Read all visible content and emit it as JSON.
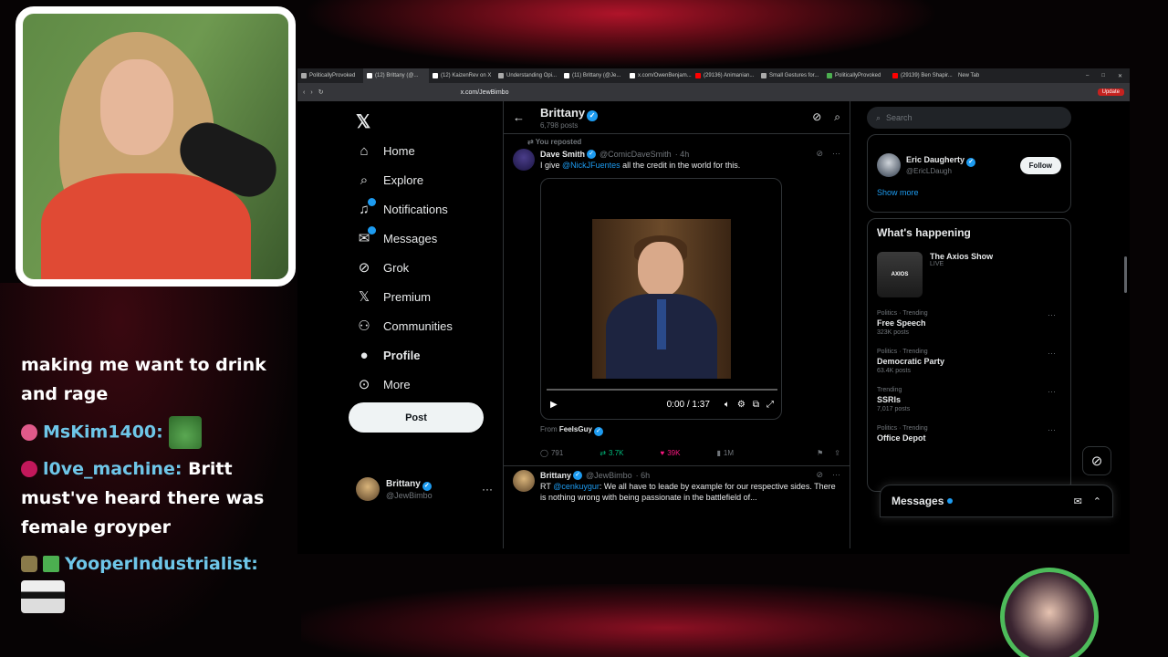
{
  "chat": {
    "line1": "making me want to drink and rage",
    "msg2_user": "MsKim1400:",
    "msg3_user": "l0ve_machine:",
    "msg3_text": "Britt must've heard there was female groyper",
    "msg4_user": "YooperIndustrialist:"
  },
  "browser": {
    "tabs": [
      "PoliticallyProvoked",
      "(12) Brittany (@...",
      "(12) KaizenRev on X",
      "Understanding Opi...",
      "(11) Brittany (@Je...",
      "x.com/OwenBenjam...",
      "(29136) Animanian...",
      "Small Gestures for...",
      "PoliticallyProvoked",
      "(29139) Ben Shapir...",
      "New Tab"
    ],
    "url": "x.com/JewBimbo",
    "update_label": "Update"
  },
  "nav": {
    "items": [
      "Home",
      "Explore",
      "Notifications",
      "Messages",
      "Grok",
      "Premium",
      "Communities",
      "Profile",
      "More"
    ],
    "post_label": "Post",
    "account_name": "Brittany",
    "account_handle": "@JewBimbo"
  },
  "profile": {
    "name": "Brittany",
    "post_count": "6,798 posts"
  },
  "tweet1": {
    "reposted_label": "You reposted",
    "author": "Dave Smith",
    "handle": "@ComicDaveSmith",
    "time": "· 4h",
    "text_pre": "I give ",
    "mention": "@NickJFuentes",
    "text_post": " all the credit in the world for this.",
    "video_time": "0:00 / 1:37",
    "from_label": "From ",
    "from_name": "FeelsGuy",
    "replies": "791",
    "reposts": "3.7K",
    "likes": "39K",
    "views": "1M"
  },
  "tweet2": {
    "author": "Brittany",
    "handle": "@JewBimbo",
    "time": "· 6h",
    "text_pre": "RT ",
    "mention": "@cenkuygur",
    "text_post": ": We all have to leade by example for our respective sides. There is nothing wrong with being passionate in the battlefield of..."
  },
  "right": {
    "search_placeholder": "Search",
    "who_name": "Eric Daugherty",
    "who_handle": "@EricLDaugh",
    "follow_label": "Follow",
    "show_more": "Show more",
    "happening_title": "What's happening",
    "live_name": "The Axios Show",
    "live_label": "LIVE",
    "live_thumb": "AXIOS",
    "trends": [
      {
        "cat": "Politics · Trending",
        "name": "Free Speech",
        "count": "323K posts"
      },
      {
        "cat": "Politics · Trending",
        "name": "Democratic Party",
        "count": "63.4K posts"
      },
      {
        "cat": "Trending",
        "name": "SSRIs",
        "count": "7,017 posts"
      },
      {
        "cat": "Politics · Trending",
        "name": "Office Depot",
        "count": ""
      }
    ]
  },
  "messages_drawer": {
    "title": "Messages"
  }
}
